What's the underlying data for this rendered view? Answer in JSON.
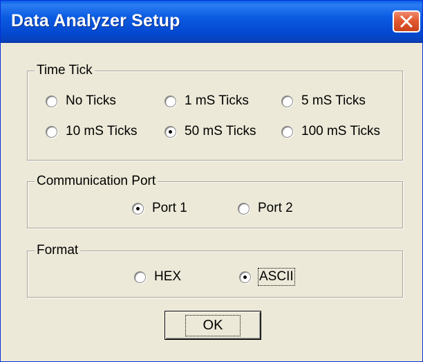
{
  "window": {
    "title": "Data Analyzer Setup",
    "close_icon": "close-x-icon",
    "colors": {
      "titlebar": "#0348cf",
      "close": "#e35a31",
      "face": "#ece9d8"
    }
  },
  "time_tick": {
    "label": "Time Tick",
    "options": [
      "No Ticks",
      "1 mS Ticks",
      "5 mS Ticks",
      "10 mS Ticks",
      "50 mS Ticks",
      "100 mS Ticks"
    ],
    "selected": "50 mS Ticks"
  },
  "comm_port": {
    "label": "Communication Port",
    "options": [
      "Port 1",
      "Port 2"
    ],
    "selected": "Port 1"
  },
  "format": {
    "label": "Format",
    "options": [
      "HEX",
      "ASCII"
    ],
    "selected": "ASCII"
  },
  "buttons": {
    "ok": "OK"
  }
}
